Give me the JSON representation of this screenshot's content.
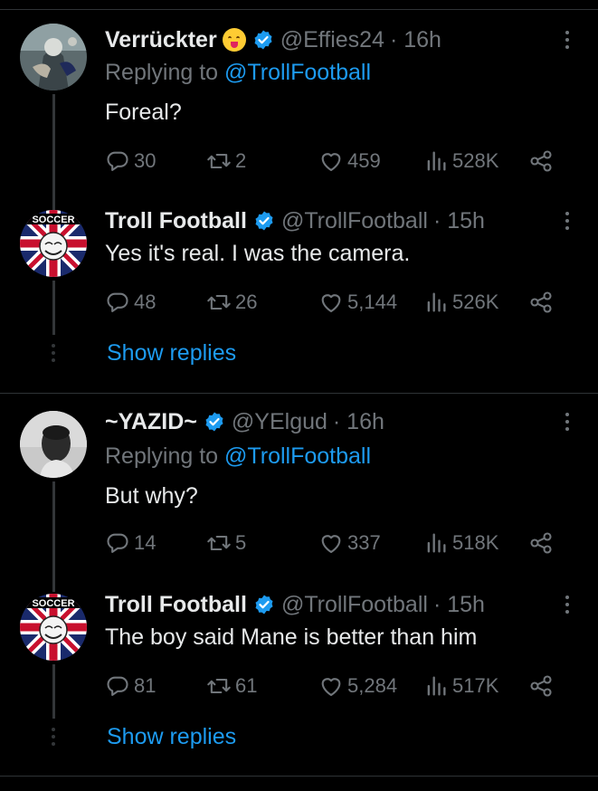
{
  "tweets": [
    {
      "name": "Verrückter",
      "handle": "@Effies24",
      "time": "· 16h",
      "replying_label": "Replying to",
      "replying_to": "@TrollFootball",
      "text": "Foreal?",
      "replies": "30",
      "reposts": "2",
      "likes": "459",
      "views": "528K"
    },
    {
      "name": "Troll Football",
      "handle": "@TrollFootball",
      "time": "· 15h",
      "text": "Yes it's real. I was the camera.",
      "replies": "48",
      "reposts": "26",
      "likes": "5,144",
      "views": "526K",
      "avatar_text": "SOCCER"
    },
    {
      "name": "~YAZID~",
      "handle": "@YElgud",
      "time": "· 16h",
      "replying_label": "Replying to",
      "replying_to": "@TrollFootball",
      "text": "But why?",
      "replies": "14",
      "reposts": "5",
      "likes": "337",
      "views": "518K"
    },
    {
      "name": "Troll Football",
      "handle": "@TrollFootball",
      "time": "· 15h",
      "text": "The boy said Mane is better than him",
      "replies": "81",
      "reposts": "61",
      "likes": "5,284",
      "views": "517K",
      "avatar_text": "SOCCER"
    }
  ],
  "show_replies": "Show replies",
  "colors": {
    "accent": "#1d9bf0",
    "muted": "#71767b",
    "text": "#e7e9ea",
    "background": "#000000"
  },
  "icons": [
    "reply-icon",
    "repost-icon",
    "like-icon",
    "views-icon",
    "share-icon",
    "verified-badge-icon",
    "more-options-icon",
    "face-savoring-food-emoji"
  ]
}
